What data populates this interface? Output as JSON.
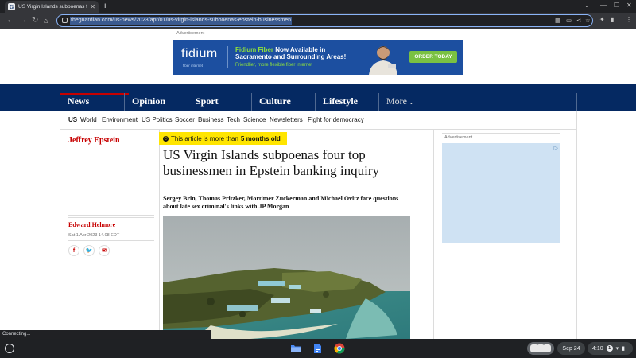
{
  "browser": {
    "tab_title": "US Virgin Islands subpoenas fou",
    "favicon_letter": "G",
    "url": "theguardian.com/us-news/2023/apr/01/us-virgin-islands-subpoenas-epstein-businessmen",
    "status_text": "Connecting..."
  },
  "ad_top": {
    "label": "Advertisement",
    "logo": "fidium",
    "logo_sub": "fiber internet",
    "headline_brand": "Fidium Fiber",
    "headline_rest": " Now Available in",
    "headline_line2": "Sacramento and Surrounding Areas!",
    "subline": "Friendlier, more flexible fiber internet",
    "cta": "ORDER TODAY"
  },
  "nav": {
    "pillars": [
      "News",
      "Opinion",
      "Sport",
      "Culture",
      "Lifestyle",
      "More"
    ],
    "subnav": [
      "US",
      "World",
      "Environment",
      "US Politics",
      "Soccer",
      "Business",
      "Tech",
      "Science",
      "Newsletters",
      "Fight for democracy"
    ]
  },
  "article": {
    "section": "Jeffrey Epstein",
    "age_prefix": "This article is more than",
    "age_value": "5 months old",
    "headline": "US Virgin Islands subpoenas four top businessmen in Epstein banking inquiry",
    "standfirst": "Sergey Brin, Thomas Pritzker, Mortimer Zuckerman and Michael Ovitz face questions about late sex criminal's links with JP Morgan",
    "byline": "Edward Helmore",
    "dateline": "Sat 1 Apr 2023 14.08 EDT"
  },
  "ad_right": {
    "label": "Advertisement"
  },
  "shelf": {
    "date": "Sep 24",
    "time": "4:10",
    "notifications": "1"
  },
  "colors": {
    "guardian_blue": "#052962",
    "news_red": "#c70000",
    "age_yellow": "#ffe500",
    "ad_blue": "#1c4fa0",
    "ad_green": "#7ac142"
  }
}
